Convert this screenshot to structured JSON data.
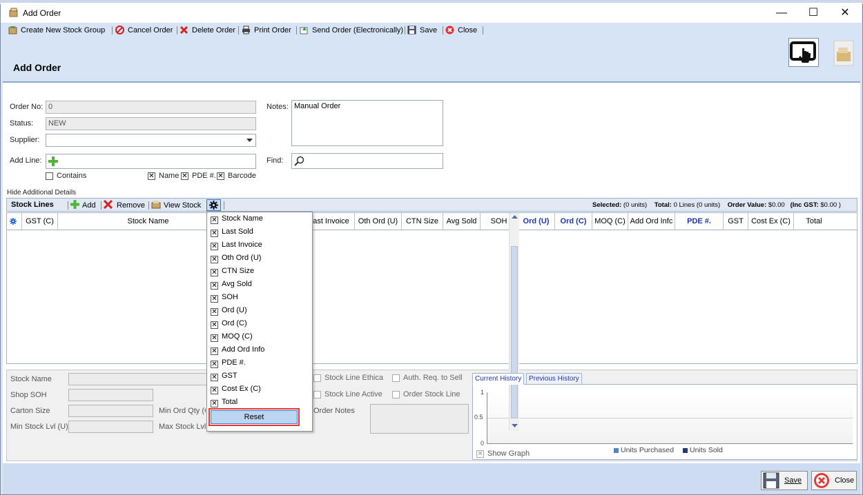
{
  "window": {
    "title": "Add Order",
    "minimize": "—",
    "maximize": "☐",
    "close": "✕"
  },
  "toolbar": {
    "create_stock_group": "Create New Stock Group",
    "cancel_order": "Cancel Order",
    "delete_order": "Delete Order",
    "print_order": "Print Order",
    "send_order": "Send Order (Electronically)",
    "save": "Save",
    "close": "Close"
  },
  "header": {
    "title": "Add Order"
  },
  "form": {
    "order_no_label": "Order No:",
    "order_no_value": "0",
    "status_label": "Status:",
    "status_value": "NEW",
    "supplier_label": "Supplier:",
    "supplier_value": "",
    "add_line_label": "Add Line:",
    "contains_label": "Contains",
    "name_label": "Name",
    "pde_label": "PDE #.",
    "barcode_label": "Barcode",
    "notes_label": "Notes:",
    "notes_value": "Manual Order",
    "find_label": "Find:",
    "hide_details": "Hide Additional Details"
  },
  "stock_lines": {
    "title": "Stock Lines",
    "add": "Add",
    "remove": "Remove",
    "view_stock": "View Stock",
    "selected_label": "Selected:",
    "selected_value": "(0 units)",
    "total_label": "Total:",
    "total_value": "0 Lines (0 units)",
    "order_value_label": "Order Value:",
    "order_value": "$0.00",
    "inc_gst_label": "(Inc GST:",
    "inc_gst_value": "$0.00 )"
  },
  "columns": [
    "GST (C)",
    "Stock Name",
    "ast Invoice",
    "Oth Ord (U)",
    "CTN Size",
    "Avg Sold",
    "SOH",
    "Ord (U)",
    "Ord (C)",
    "MOQ (C)",
    "Add Ord Infc",
    "PDE #.",
    "GST",
    "Cost Ex (C)",
    "Total"
  ],
  "column_menu": {
    "items": [
      "Stock Name",
      "Last Sold",
      "Last Invoice",
      "Oth Ord (U)",
      "CTN Size",
      "Avg Sold",
      "SOH",
      "Ord (U)",
      "Ord (C)",
      "MOQ (C)",
      "Add Ord Info",
      "PDE #.",
      "GST",
      "Cost Ex (C)",
      "Total"
    ],
    "reset": "Reset"
  },
  "details": {
    "stock_name": "Stock Name",
    "shop_soh": "Shop SOH",
    "carton_size": "Carton Size",
    "min_stock_lvl": "Min Stock Lvl (U)",
    "min_ord_qty": "Min Ord Qty (C",
    "max_stock_lvl": "Max Stock Lvl",
    "stock_line_ethical": "Stock Line Ethica",
    "auth_req": "Auth. Req. to Sell",
    "stock_line_active": "Stock Line Active",
    "order_stock_line": "Order Stock Line",
    "order_notes": "Order Notes"
  },
  "history": {
    "tab_current": "Current History",
    "tab_previous": "Previous History",
    "y_ticks": [
      "1",
      "0.5",
      "0"
    ],
    "legend_purchased": "Units Purchased",
    "legend_sold": "Units Sold",
    "show_graph": "Show Graph"
  },
  "footer": {
    "save": "Save",
    "close": "Close"
  },
  "colors": {
    "accent": "#1733c6",
    "highlight": "#e53935"
  }
}
